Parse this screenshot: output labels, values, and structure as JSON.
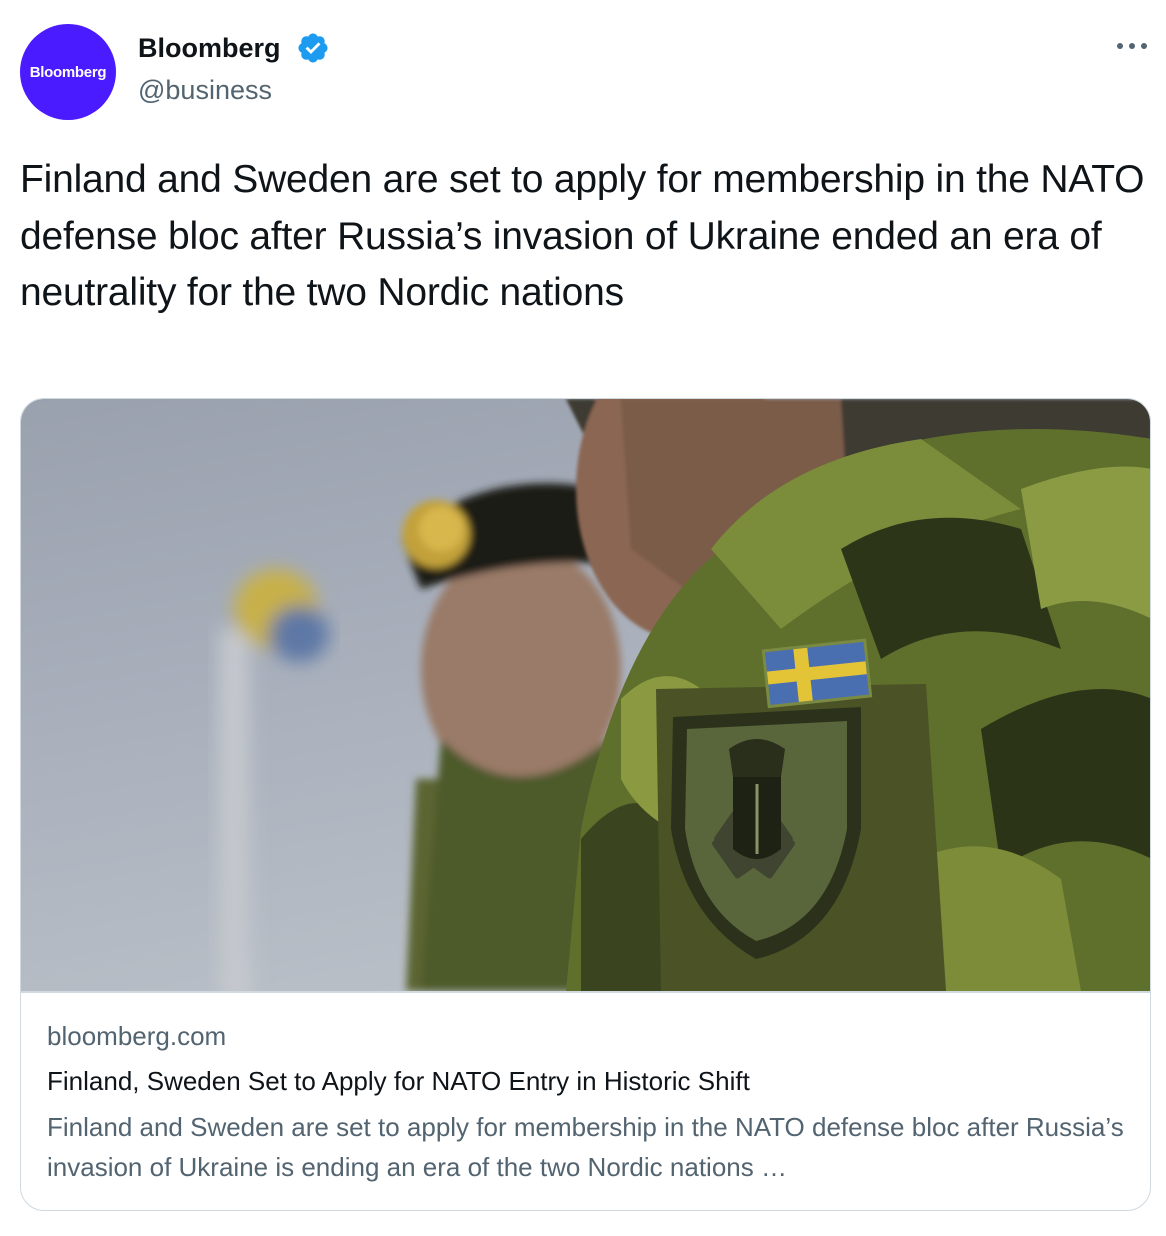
{
  "author": {
    "avatar_text": "Bloomberg",
    "name": "Bloomberg",
    "handle": "@business",
    "verified_icon": "verified-badge-icon",
    "more_icon": "more-horizontal-icon"
  },
  "tweet": {
    "text": "Finland and Sweden are set to apply for membership in the NATO defense bloc after Russia’s invasion of Ukraine ended an era of neutrality for the two Nordic nations"
  },
  "card": {
    "domain": "bloomberg.com",
    "title": "Finland, Sweden Set to Apply for NATO Entry in Historic Shift",
    "description": "Finland and Sweden are set to apply for membership in the NATO defense bloc after Russia’s invasion of Ukraine is ending an era of the two Nordic nations …"
  },
  "colors": {
    "avatar_bg": "#4a1bff",
    "verified_blue": "#1d9bf0",
    "secondary_text": "#536471",
    "border": "#cfd9de"
  }
}
